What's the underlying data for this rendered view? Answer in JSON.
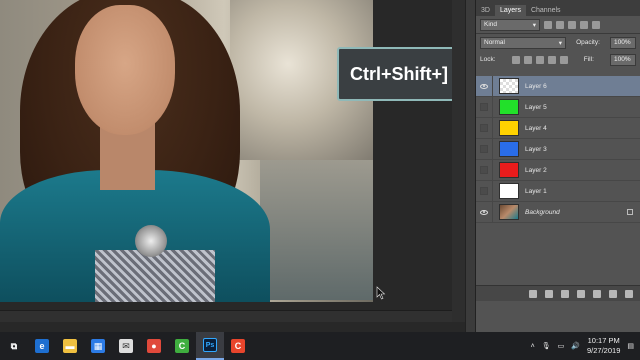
{
  "hint": {
    "text": "Ctrl+Shift+]"
  },
  "panel": {
    "tabs": [
      "3D",
      "Layers",
      "Channels"
    ],
    "active_tab": "Layers",
    "filter_kind": "Kind",
    "blend_mode": "Normal",
    "opacity_label": "Opacity:",
    "opacity_value": "100%",
    "lock_label": "Lock:",
    "fill_label": "Fill:",
    "fill_value": "100%"
  },
  "layers": [
    {
      "name": "Layer 6",
      "color": "checker",
      "visible": true,
      "selected": true
    },
    {
      "name": "Layer 5",
      "color": "#22e02a",
      "visible": false,
      "selected": false
    },
    {
      "name": "Layer 4",
      "color": "#ffd200",
      "visible": false,
      "selected": false
    },
    {
      "name": "Layer 3",
      "color": "#2a6de8",
      "visible": false,
      "selected": false
    },
    {
      "name": "Layer 2",
      "color": "#ea1c1c",
      "visible": false,
      "selected": false
    },
    {
      "name": "Layer 1",
      "color": "#ffffff",
      "visible": false,
      "selected": false
    },
    {
      "name": "Background",
      "color": "photo",
      "visible": true,
      "selected": false,
      "locked": true
    }
  ],
  "panel_bottom_icons": [
    "link-icon",
    "fx-icon",
    "mask-icon",
    "adjustment-icon",
    "group-icon",
    "new-layer-icon",
    "trash-icon"
  ],
  "taskbar": {
    "apps": [
      {
        "name": "task-view-icon",
        "color": "#1e1f22",
        "glyph": "⧉"
      },
      {
        "name": "edge-icon",
        "color": "#1e6fd1",
        "glyph": "e"
      },
      {
        "name": "file-explorer-icon",
        "color": "#f0c040",
        "glyph": "▬"
      },
      {
        "name": "store-icon",
        "color": "#2c7be5",
        "glyph": "▦"
      },
      {
        "name": "mail-icon",
        "color": "#dddddd",
        "glyph": "✉"
      },
      {
        "name": "chrome-icon",
        "color": "#e0493b",
        "glyph": "●"
      },
      {
        "name": "camtasia-icon",
        "color": "#3fae3f",
        "glyph": "C"
      },
      {
        "name": "photoshop-icon",
        "color": "#0a1f3a",
        "glyph": "Ps"
      },
      {
        "name": "camtasia-recorder-icon",
        "color": "#e8452c",
        "glyph": "C"
      }
    ],
    "time": "10:17 PM",
    "date": "9/27/2019"
  }
}
